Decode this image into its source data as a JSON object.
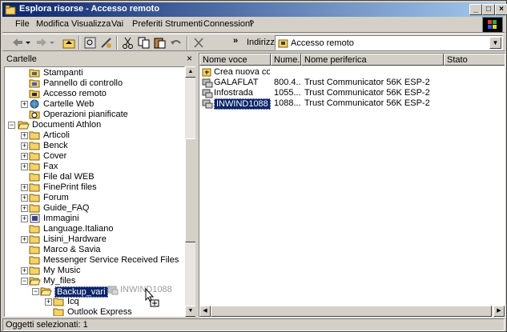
{
  "window": {
    "title": "Esplora risorse - Accesso remoto"
  },
  "menu": [
    {
      "label": "File"
    },
    {
      "label": "Modifica"
    },
    {
      "label": "Visualizza"
    },
    {
      "label": "Vai"
    },
    {
      "label": "Preferiti"
    },
    {
      "label": "Strumenti"
    },
    {
      "label": "Connessioni"
    },
    {
      "label": "?"
    }
  ],
  "toolbar": {
    "more": "»",
    "address_label": "Indirizzo",
    "address_value": "Accesso remoto"
  },
  "left_pane": {
    "title": "Cartelle",
    "close": "×",
    "tree": [
      {
        "label": "Stampanti"
      },
      {
        "label": "Pannello di controllo"
      },
      {
        "label": "Accesso remoto"
      },
      {
        "label": "Cartelle Web"
      },
      {
        "label": "Operazioni pianificate"
      },
      {
        "label": "Documenti Athlon"
      },
      {
        "label": "Articoli"
      },
      {
        "label": "Benck"
      },
      {
        "label": "Cover"
      },
      {
        "label": "Fax"
      },
      {
        "label": "File dal WEB"
      },
      {
        "label": "FinePrint files"
      },
      {
        "label": "Forum"
      },
      {
        "label": "Guide_FAQ"
      },
      {
        "label": "Immagini"
      },
      {
        "label": "Language.Italiano"
      },
      {
        "label": "Lisini_Hardware"
      },
      {
        "label": "Marco & Savia"
      },
      {
        "label": "Messenger Service Received Files"
      },
      {
        "label": "My Music"
      },
      {
        "label": "My_files"
      },
      {
        "label": "Backup_vari"
      },
      {
        "label": "Icq"
      },
      {
        "label": "Outlook Express"
      }
    ]
  },
  "right_pane": {
    "columns": [
      {
        "label": "Nome voce"
      },
      {
        "label": "Nume..."
      },
      {
        "label": "Nome periferica"
      },
      {
        "label": "Stato"
      }
    ],
    "rows": [
      {
        "name": "Crea nuova con...",
        "number": "",
        "device": ""
      },
      {
        "name": "GALAFLAT",
        "number": "800.4...",
        "device": "Trust Communicator 56K ESP-2"
      },
      {
        "name": "Infostrada",
        "number": "1055...",
        "device": "Trust Communicator 56K ESP-2"
      },
      {
        "name": "INWIND1088",
        "number": "1088...",
        "device": "Trust Communicator 56K ESP-2"
      }
    ]
  },
  "drag_ghost": {
    "label": "INWIND1088"
  },
  "status": {
    "text": "Oggetti selezionati: 1"
  }
}
